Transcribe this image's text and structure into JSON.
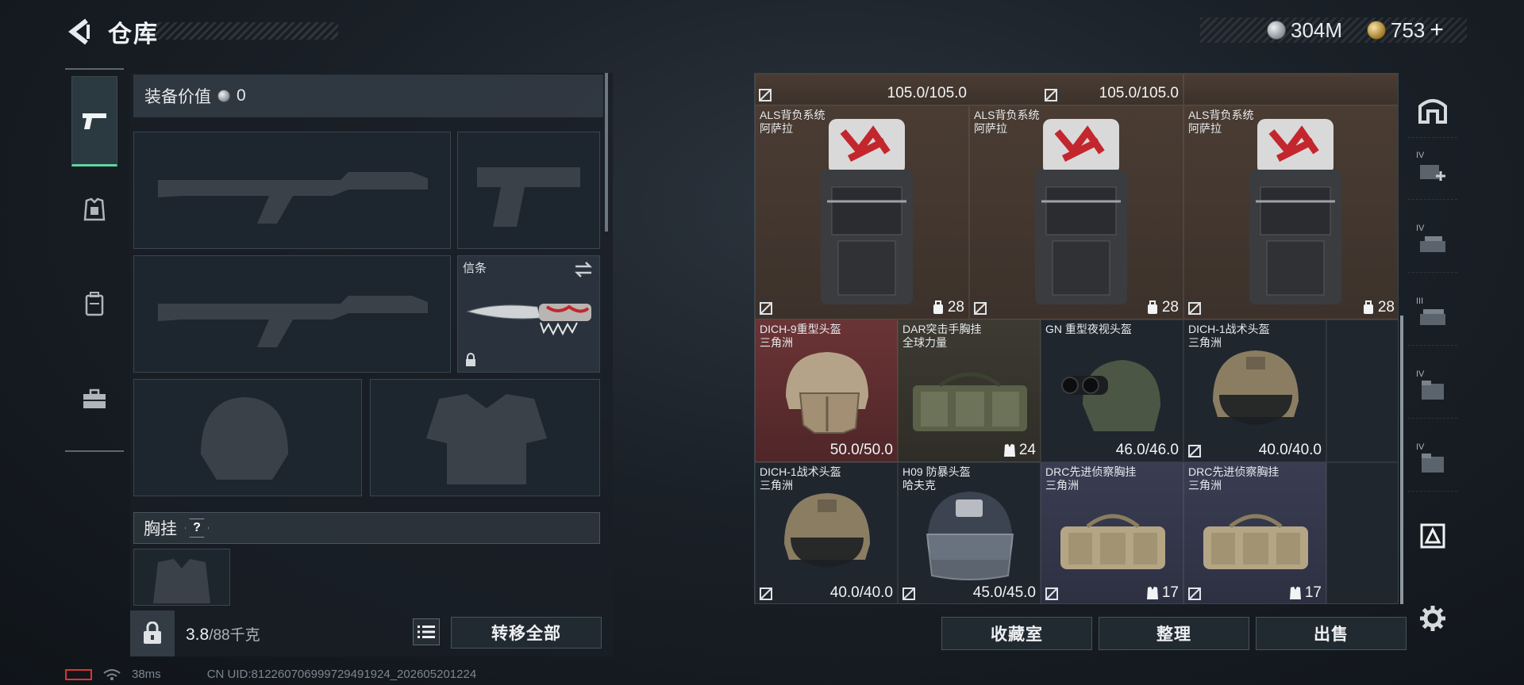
{
  "header": {
    "title": "仓库",
    "currency_silver": "304M",
    "currency_gold": "753",
    "plus": "+"
  },
  "equipment": {
    "value_label": "装备价值",
    "value": "0",
    "knife_label": "信条",
    "chest_label": "胸挂",
    "help": "?"
  },
  "footer": {
    "weight_current": "3.8",
    "weight_max": "/88千克",
    "transfer_all": "转移全部",
    "ping": "38ms",
    "uid": "CN UID:812260706999729491924_202605201224"
  },
  "inventory": {
    "top_row": [
      {
        "stat": "105.0/105.0"
      },
      {
        "stat": "105.0/105.0"
      }
    ],
    "backpacks": [
      {
        "name": "ALS背负系统",
        "brand": "阿萨拉",
        "stat": "28"
      },
      {
        "name": "ALS背负系统",
        "brand": "阿萨拉",
        "stat": "28"
      },
      {
        "name": "ALS背负系统",
        "brand": "阿萨拉",
        "stat": "28"
      }
    ],
    "row2": [
      {
        "name": "DICH-9重型头盔",
        "brand": "三角洲",
        "stat": "50.0/50.0",
        "color": "#6b3436"
      },
      {
        "name": "DAR突击手胸挂",
        "brand": "全球力量",
        "stat": "24",
        "color": "#3d3a32"
      },
      {
        "name": "GN 重型夜视头盔",
        "brand": "",
        "stat": "46.0/46.0",
        "color": "#2b323a"
      },
      {
        "name": "DICH-1战术头盔",
        "brand": "三角洲",
        "stat": "40.0/40.0",
        "color": "#2b323a"
      }
    ],
    "row3": [
      {
        "name": "DICH-1战术头盔",
        "brand": "三角洲",
        "stat": "40.0/40.0",
        "color": "#2b323a"
      },
      {
        "name": "H09 防暴头盔",
        "brand": "哈夫克",
        "stat": "45.0/45.0",
        "color": "#2b323a"
      },
      {
        "name": "DRC先进侦察胸挂",
        "brand": "三角洲",
        "stat": "17",
        "color": "#3a3d52"
      },
      {
        "name": "DRC先进侦察胸挂",
        "brand": "三角洲",
        "stat": "17",
        "color": "#3a3d52"
      }
    ]
  },
  "actions": {
    "collection": "收藏室",
    "organize": "整理",
    "sell": "出售"
  },
  "rail": {
    "tier_labels": [
      "IV",
      "IV",
      "III",
      "IV",
      "IV"
    ]
  },
  "colors": {
    "accent_green": "#5fd5a0",
    "panel_dark": "#191f26"
  }
}
